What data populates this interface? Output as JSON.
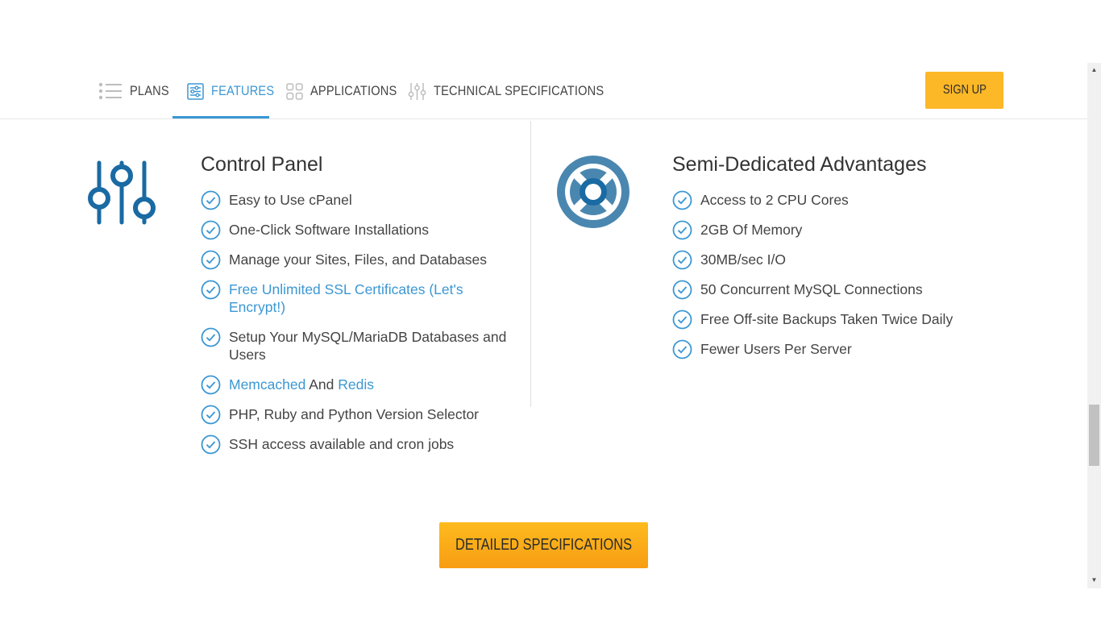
{
  "nav": {
    "tabs": [
      {
        "label": "PLANS",
        "icon": "list-icon"
      },
      {
        "label": "FEATURES",
        "icon": "sliders-doc-icon"
      },
      {
        "label": "APPLICATIONS",
        "icon": "grid-icon"
      },
      {
        "label": "TECHNICAL SPECIFICATIONS",
        "icon": "sliders-icon"
      }
    ],
    "active_tab": "FEATURES",
    "signup_label": "SIGN UP"
  },
  "control_panel": {
    "title": "Control Panel",
    "items": [
      {
        "text": "Easy to Use cPanel"
      },
      {
        "text": "One-Click Software Installations"
      },
      {
        "text": "Manage your Sites, Files, and Databases"
      },
      {
        "line1": "Free Unlimited SSL Certificates (Let's",
        "line2": "Encrypt!)"
      },
      {
        "line1": "Setup Your MySQL/MariaDB Databases and",
        "line2": "Users"
      },
      {
        "link1": "Memcached",
        "mid": " And ",
        "link2": "Redis"
      },
      {
        "text": "PHP, Ruby and Python Version Selector"
      },
      {
        "text": "SSH access available and cron jobs"
      }
    ]
  },
  "advantages": {
    "title": "Semi-Dedicated Advantages",
    "items": [
      {
        "text": "Access to 2 CPU Cores"
      },
      {
        "text": "2GB Of Memory"
      },
      {
        "text": "30MB/sec I/O"
      },
      {
        "text": "50 Concurrent MySQL Connections"
      },
      {
        "text": "Free Off-site Backups Taken Twice Daily"
      },
      {
        "text": "Fewer Users Per Server"
      }
    ]
  },
  "detail_button_label": "DETAILED SPECIFICATIONS",
  "colors": {
    "accent": "#3b97d3",
    "button": "#fdb827",
    "icon_dark": "#1a6aa3"
  }
}
